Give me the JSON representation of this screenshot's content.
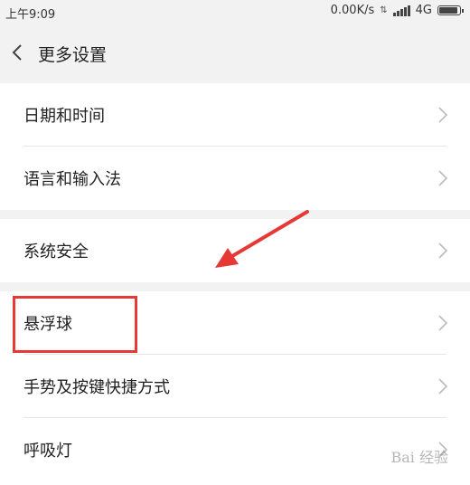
{
  "status_bar": {
    "time": "上午9:09",
    "net_speed": "0.00K/s",
    "network": "4G",
    "battery_level": 0.85
  },
  "header": {
    "title": "更多设置"
  },
  "settings": {
    "group1": [
      {
        "label": "日期和时间"
      },
      {
        "label": "语言和输入法"
      }
    ],
    "group2": [
      {
        "label": "系统安全"
      }
    ],
    "group3": [
      {
        "label": "悬浮球"
      },
      {
        "label": "手势及按键快捷方式"
      },
      {
        "label": "呼吸灯"
      }
    ]
  },
  "annotation": {
    "highlight_color": "#e53935"
  },
  "watermark": {
    "text": "Bai 经验"
  }
}
